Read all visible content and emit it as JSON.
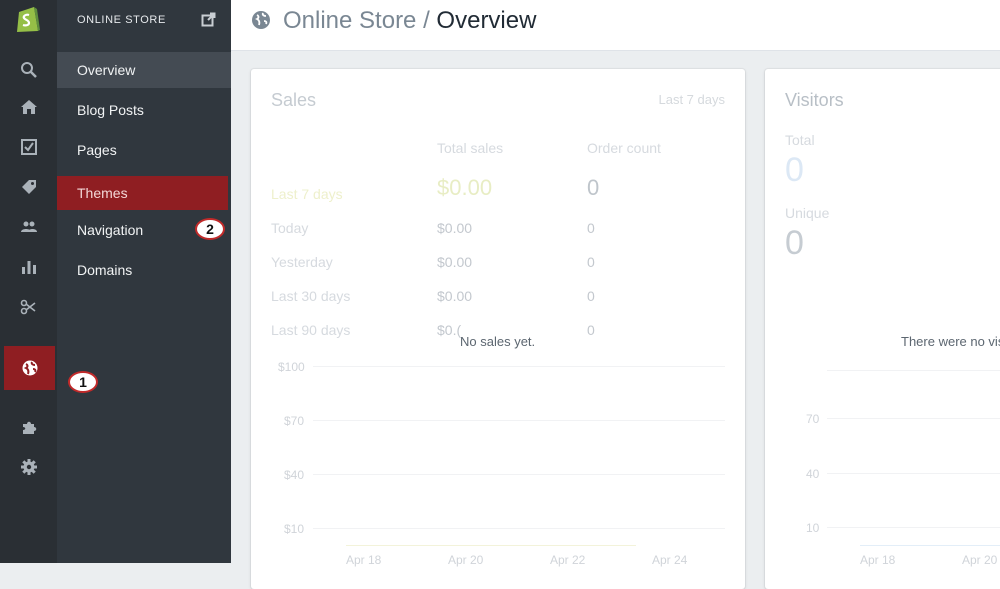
{
  "rail": {
    "items": [
      {
        "name": "search",
        "icon": "search-icon"
      },
      {
        "name": "home",
        "icon": "home-icon"
      },
      {
        "name": "orders",
        "icon": "orders-checkbox-icon"
      },
      {
        "name": "products",
        "icon": "tag-icon"
      },
      {
        "name": "customers",
        "icon": "customers-icon"
      },
      {
        "name": "reports",
        "icon": "bar-chart-icon"
      },
      {
        "name": "discounts",
        "icon": "scissors-icon"
      },
      {
        "name": "online-store",
        "icon": "globe-icon",
        "active": true
      },
      {
        "name": "apps",
        "icon": "puzzle-icon"
      },
      {
        "name": "settings",
        "icon": "gear-icon"
      }
    ]
  },
  "subnav": {
    "title": "ONLINE STORE",
    "items": [
      {
        "label": "Overview",
        "selected": true
      },
      {
        "label": "Blog Posts"
      },
      {
        "label": "Pages"
      },
      {
        "label": "Themes",
        "highlight": true
      },
      {
        "label": "Navigation"
      },
      {
        "label": "Domains"
      }
    ]
  },
  "badges": {
    "one": "1",
    "two": "2"
  },
  "header": {
    "section": "Online Store",
    "separator": " / ",
    "current": "Overview"
  },
  "sales": {
    "title": "Sales",
    "range": "Last 7 days",
    "col_total": "Total sales",
    "col_orders": "Order count",
    "rows": [
      {
        "period": "Last 7 days",
        "total": "$0.00",
        "count": "0"
      },
      {
        "period": "Today",
        "total": "$0.00",
        "count": "0"
      },
      {
        "period": "Yesterday",
        "total": "$0.00",
        "count": "0"
      },
      {
        "period": "Last 30 days",
        "total": "$0.00",
        "count": "0"
      },
      {
        "period": "Last 90 days",
        "total": "$0.(",
        "count": "0"
      }
    ],
    "empty_message": "No sales yet.",
    "y_ticks": [
      "$100",
      "$70",
      "$40",
      "$10"
    ],
    "x_ticks": [
      "Apr 18",
      "Apr 20",
      "Apr 22",
      "Apr 24"
    ]
  },
  "visitors": {
    "title": "Visitors",
    "total_label": "Total",
    "total_value": "0",
    "unique_label": "Unique",
    "unique_value": "0",
    "empty_message": "There were no vis",
    "y_ticks": [
      "70",
      "40",
      "10"
    ],
    "x_ticks": [
      "Apr 18",
      "Apr 20"
    ]
  },
  "colors": {
    "rail_bg": "#2a2f34",
    "subnav_bg": "#30373e",
    "accent_red": "#8f1e22",
    "badge_border": "#c12a2a"
  }
}
